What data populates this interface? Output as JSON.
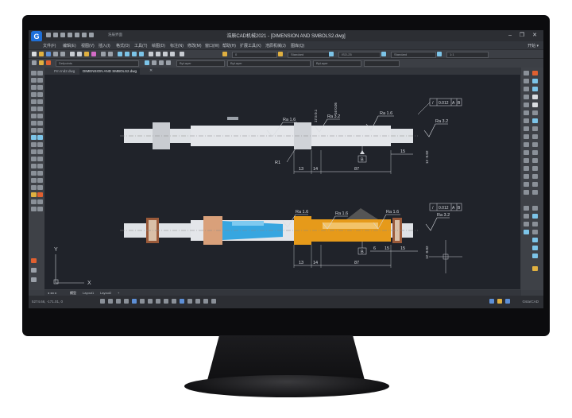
{
  "window": {
    "title": "浩辰CAD机械2021 - [DIMENSION AND SMBOLS2.dwg]",
    "logo_letter": "G",
    "controls": "– ❐ ✕",
    "search_text": "浩辰界面"
  },
  "menu": {
    "items": [
      "文件(F)",
      "编辑(E)",
      "视图(V)",
      "插入(I)",
      "格式(O)",
      "工具(T)",
      "绘图(D)",
      "标注(N)",
      "修改(M)",
      "窗口(W)",
      "帮助(H)",
      "扩展工具(X)",
      "浩辰机械(J)",
      "图库(Q)"
    ],
    "right_label": "开始 ▾"
  },
  "toolbar2": {
    "layer": "0",
    "text_style": "Standard",
    "dim_style": "ISO-25",
    "table_style": "Standard",
    "scale": "1:1"
  },
  "toolbar3": {
    "layer_name": "Defpoints",
    "color": "ByLayer",
    "linetype": "ByLayer",
    "lineweight": "ByLayer"
  },
  "doc_tabs": [
    "Pm Ind2.dwg",
    "DIMENSION AND SMBOLS2.dwg"
  ],
  "layout_tabs": [
    "模型",
    "Layout1",
    "Layout2",
    "+"
  ],
  "status": {
    "coords": "5274.66, -171.01, 0",
    "brand": "GstarCAD"
  },
  "drawing": {
    "top_labels": [
      "Ra 1.6",
      "Ra 3.2",
      "Ra 1.6",
      "Ra 3.2",
      "R1",
      "B"
    ],
    "top_dims": [
      "13",
      "14",
      "87",
      "15"
    ],
    "top_vertical_dims": [
      "17.5 0.1",
      "16 0.05",
      "12 -0.02"
    ],
    "fcf": {
      "symbol": "/",
      "tol": "0.012",
      "datum_a": "A",
      "datum_b": "B"
    },
    "bottom_labels": [
      "Ra 1.6",
      "Ra 1.6",
      "Ra 1.6",
      "Ra 3.2",
      "B"
    ],
    "bottom_dims": [
      "13",
      "14",
      "87",
      "6",
      "15",
      "15"
    ],
    "bottom_vertical_dims": [
      "12 -0.02"
    ],
    "ucs_x": "X",
    "ucs_y": "Y"
  },
  "colors": {
    "canvas_bg": "#20232a",
    "shaft": "#dfe2e6",
    "part_orange": "#e69a1a",
    "part_blue": "#37a6e0",
    "bearing_brown": "#9a5a3a",
    "dim_line": "#d8dbe0"
  }
}
